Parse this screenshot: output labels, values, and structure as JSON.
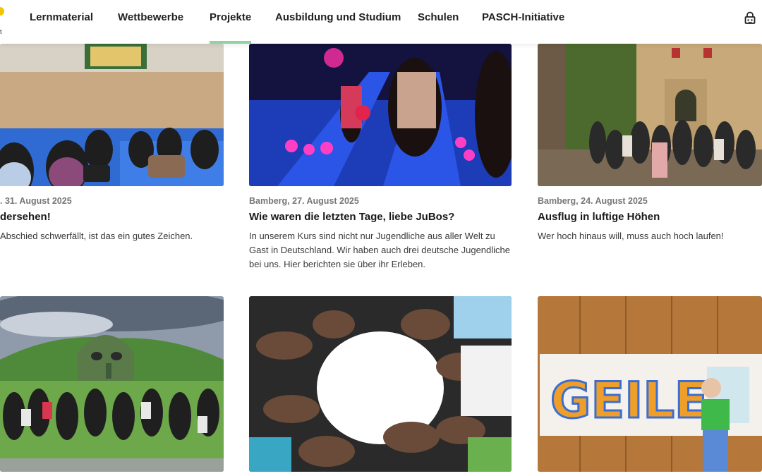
{
  "nav": {
    "logo_fragment": "t",
    "items": [
      {
        "label": "Lernmaterial"
      },
      {
        "label": "Wettbewerbe"
      },
      {
        "label": "Projekte"
      },
      {
        "label": "Ausbildung und Studium"
      },
      {
        "label": "Schulen"
      },
      {
        "label": "PASCH-Initiative"
      }
    ],
    "active": "Projekte",
    "lock_icon": "lock-icon"
  },
  "colors": {
    "active_underline": "#8fd3a0",
    "meta_text": "#777777",
    "title_text": "#1a1a1a"
  },
  "articles": [
    {
      "meta": ". 31. August 2025",
      "title": "dersehen!",
      "teaser": " Abschied schwerfällt, ist das ein gutes Zeichen.",
      "image_icon": "group-sitting-photo"
    },
    {
      "meta": "Bamberg, 27. August 2025",
      "title": "Wie waren die letzten Tage, liebe JuBos?",
      "teaser": "In unserem Kurs sind nicht nur Jugendliche aus aller Welt zu Gast in Deutschland. Wir haben auch drei deutsche Jugendliche bei uns. Hier berichten sie über ihr Erleben.",
      "image_icon": "bowling-photo"
    },
    {
      "meta": "Bamberg, 24. August 2025",
      "title": "Ausflug in luftige Höhen",
      "teaser": "Wer hoch hinaus will, muss auch hoch laufen!",
      "image_icon": "castle-group-photo"
    },
    {
      "meta": "",
      "title": "",
      "teaser": "",
      "image_icon": "hill-giant-group-photo"
    },
    {
      "meta": "",
      "title": "",
      "teaser": "",
      "image_icon": "hands-circle-photo"
    },
    {
      "meta": "",
      "title": "",
      "teaser": "",
      "image_icon": "graffiti-banner-photo",
      "banner_text": "GEILE"
    }
  ]
}
